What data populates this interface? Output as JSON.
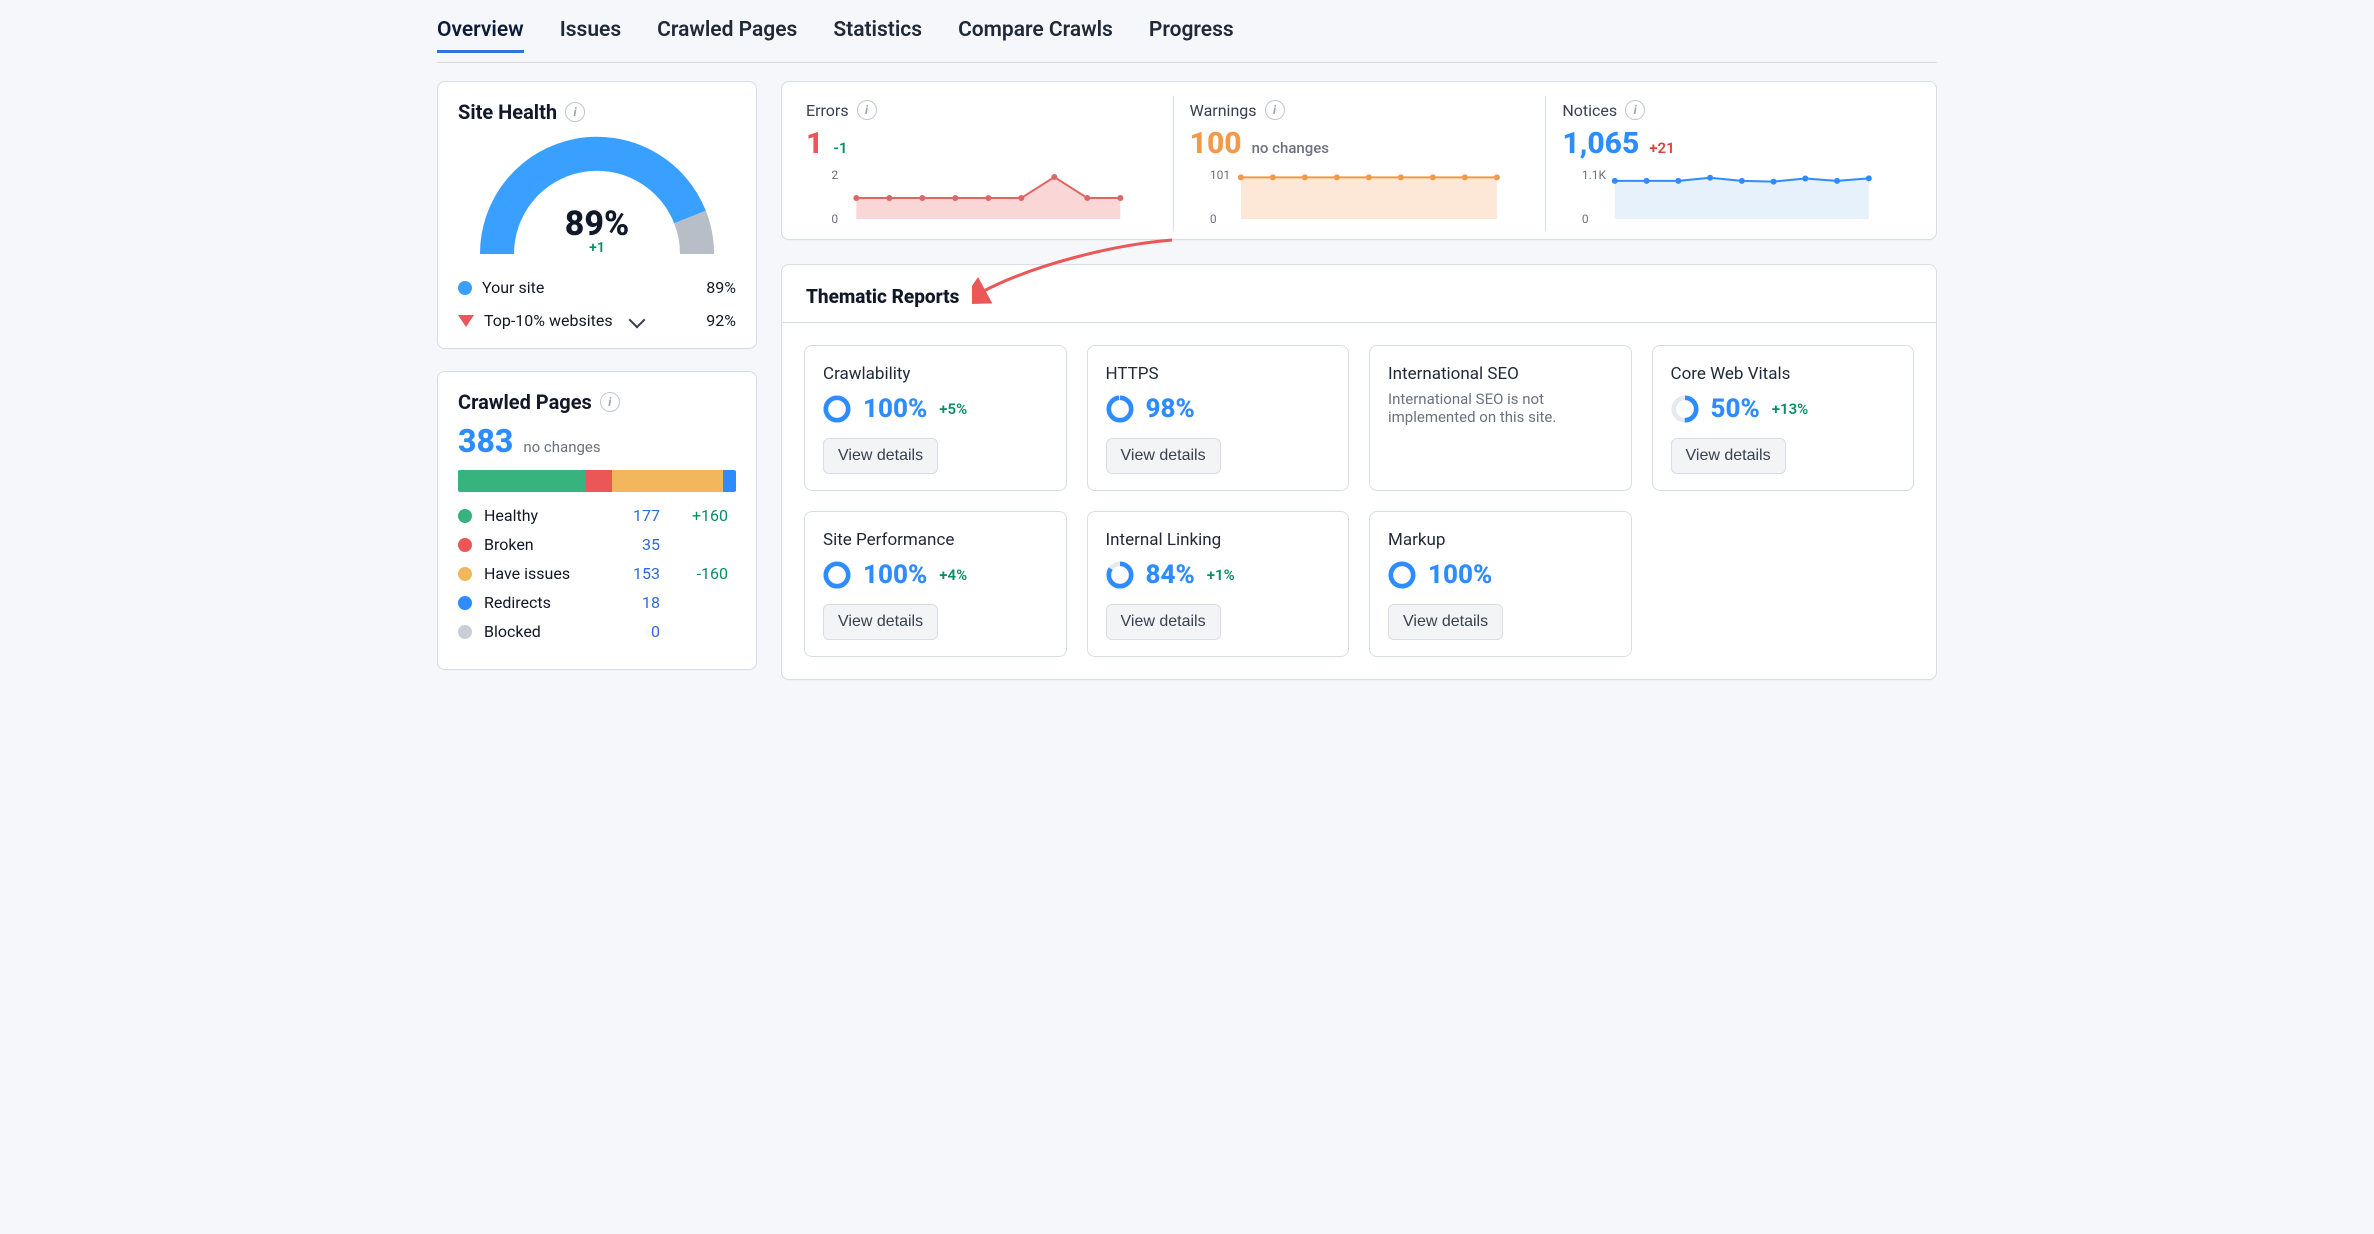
{
  "tabs": [
    "Overview",
    "Issues",
    "Crawled Pages",
    "Statistics",
    "Compare Crawls",
    "Progress"
  ],
  "active_tab_index": 0,
  "site_health": {
    "title": "Site Health",
    "score_pct": "89%",
    "score_delta": "+1",
    "legend": {
      "your_site_label": "Your site",
      "your_site_value": "89%",
      "top10_label": "Top-10% websites",
      "top10_value": "92%"
    }
  },
  "crawled_pages": {
    "title": "Crawled Pages",
    "total": "383",
    "change_text": "no changes",
    "segments": [
      {
        "key": "healthy",
        "label": "Healthy",
        "value": 177,
        "delta": "+160",
        "color": "#36b37e"
      },
      {
        "key": "broken",
        "label": "Broken",
        "value": 35,
        "delta": "",
        "color": "#eb5757"
      },
      {
        "key": "issues",
        "label": "Have issues",
        "value": 153,
        "delta": "-160",
        "color": "#f2b75c"
      },
      {
        "key": "redirects",
        "label": "Redirects",
        "value": 18,
        "delta": "",
        "color": "#2d8cff"
      },
      {
        "key": "blocked",
        "label": "Blocked",
        "value": 0,
        "delta": "",
        "color": "#c9ced6"
      }
    ]
  },
  "issue_stats": {
    "errors": {
      "label": "Errors",
      "value": "1",
      "delta": "-1",
      "delta_class": "down",
      "color": "red",
      "axis_top": "2",
      "axis_bottom": "0"
    },
    "warnings": {
      "label": "Warnings",
      "value": "100",
      "delta": "no changes",
      "delta_class": "muted",
      "color": "orange",
      "axis_top": "101",
      "axis_bottom": "0"
    },
    "notices": {
      "label": "Notices",
      "value": "1,065",
      "delta": "+21",
      "delta_class": "up",
      "color": "blue",
      "axis_top": "1.1K",
      "axis_bottom": "0"
    }
  },
  "chart_data": [
    {
      "id": "errors-spark",
      "type": "line",
      "ylim": [
        0,
        2
      ],
      "x": [
        0,
        1,
        2,
        3,
        4,
        5,
        6,
        7,
        8
      ],
      "values": [
        1,
        1,
        1,
        1,
        1,
        1,
        2,
        1,
        1
      ],
      "stroke": "#e06666",
      "fill": "#f6b3b388"
    },
    {
      "id": "warnings-spark",
      "type": "line",
      "ylim": [
        0,
        101
      ],
      "x": [
        0,
        1,
        2,
        3,
        4,
        5,
        6,
        7,
        8
      ],
      "values": [
        100,
        100,
        100,
        100,
        100,
        100,
        100,
        100,
        100
      ],
      "stroke": "#f2994a",
      "fill": "#f9c49a66"
    },
    {
      "id": "notices-spark",
      "type": "line",
      "ylim": [
        0,
        1100
      ],
      "x": [
        0,
        1,
        2,
        3,
        4,
        5,
        6,
        7,
        8
      ],
      "values": [
        1000,
        1000,
        1000,
        1080,
        1000,
        980,
        1060,
        1000,
        1065
      ],
      "stroke": "#2d8cff",
      "fill": "#b8d6f655"
    }
  ],
  "thematic": {
    "title": "Thematic Reports",
    "view_details_label": "View details",
    "reports": [
      {
        "key": "crawlability",
        "title": "Crawlability",
        "pct": "100%",
        "delta": "+5%",
        "donut": 100
      },
      {
        "key": "https",
        "title": "HTTPS",
        "pct": "98%",
        "delta": "",
        "donut": 98
      },
      {
        "key": "intl",
        "title": "International SEO",
        "note": "International SEO is not implemented on this site."
      },
      {
        "key": "cwv",
        "title": "Core Web Vitals",
        "pct": "50%",
        "delta": "+13%",
        "donut": 50
      },
      {
        "key": "perf",
        "title": "Site Performance",
        "pct": "100%",
        "delta": "+4%",
        "donut": 100
      },
      {
        "key": "linking",
        "title": "Internal Linking",
        "pct": "84%",
        "delta": "+1%",
        "donut": 84
      },
      {
        "key": "markup",
        "title": "Markup",
        "pct": "100%",
        "delta": "",
        "donut": 100
      }
    ]
  }
}
